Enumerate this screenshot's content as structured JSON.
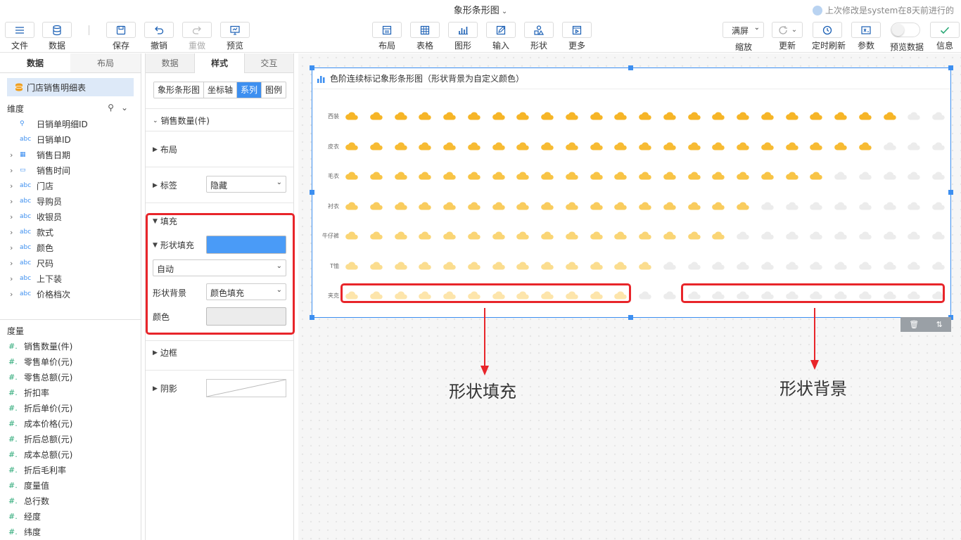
{
  "header": {
    "title": "象形条形图",
    "last_modified": "上次修改是system在8天前进行的"
  },
  "toolbar_left": [
    {
      "name": "file-button",
      "icon": "menu-icon",
      "label": "文件",
      "disabled": false
    },
    {
      "name": "data-button",
      "icon": "database-icon",
      "label": "数据",
      "disabled": false
    },
    {
      "name": "save-button",
      "icon": "save-icon",
      "label": "保存",
      "disabled": false
    },
    {
      "name": "undo-button",
      "icon": "undo-icon",
      "label": "撤销",
      "disabled": false
    },
    {
      "name": "redo-button",
      "icon": "redo-icon",
      "label": "重做",
      "disabled": true
    },
    {
      "name": "preview-button",
      "icon": "monitor-icon",
      "label": "预览",
      "disabled": false
    }
  ],
  "toolbar_center": [
    {
      "name": "layout-button",
      "icon": "layout-icon",
      "label": "布局"
    },
    {
      "name": "table-button",
      "icon": "table-icon",
      "label": "表格"
    },
    {
      "name": "chart-button",
      "icon": "bar-chart-icon",
      "label": "图形"
    },
    {
      "name": "input-button",
      "icon": "edit-icon",
      "label": "输入"
    },
    {
      "name": "shape-button",
      "icon": "shapes-icon",
      "label": "形状"
    },
    {
      "name": "more-button",
      "icon": "play-box-icon",
      "label": "更多"
    }
  ],
  "toolbar_right": {
    "zoom_value": "满屏",
    "zoom_label": "缩放",
    "refresh_label": "更新",
    "timed_refresh_label": "定时刷新",
    "params_label": "参数",
    "preview_data_label": "预览数据",
    "info_label": "信息"
  },
  "left_panel": {
    "tabs": [
      "数据",
      "布局"
    ],
    "dataset": "门店销售明细表",
    "dimension_title": "维度",
    "dimensions": [
      {
        "type": "key",
        "name": "日销单明细ID",
        "expandable": false
      },
      {
        "type": "abc",
        "name": "日销单ID",
        "expandable": false
      },
      {
        "type": "date",
        "name": "销售日期",
        "expandable": true
      },
      {
        "type": "time",
        "name": "销售时间",
        "expandable": true
      },
      {
        "type": "abc",
        "name": "门店",
        "expandable": true
      },
      {
        "type": "abc",
        "name": "导购员",
        "expandable": true
      },
      {
        "type": "abc",
        "name": "收银员",
        "expandable": true
      },
      {
        "type": "abc",
        "name": "款式",
        "expandable": true
      },
      {
        "type": "abc",
        "name": "颜色",
        "expandable": true
      },
      {
        "type": "abc",
        "name": "尺码",
        "expandable": true
      },
      {
        "type": "abc",
        "name": "上下装",
        "expandable": true
      },
      {
        "type": "abc",
        "name": "价格档次",
        "expandable": true
      }
    ],
    "measure_title": "度量",
    "measures": [
      "销售数量(件)",
      "零售单价(元)",
      "零售总额(元)",
      "折扣率",
      "折后单价(元)",
      "成本价格(元)",
      "折后总额(元)",
      "成本总额(元)",
      "折后毛利率",
      "度量值",
      "总行数",
      "经度",
      "纬度"
    ]
  },
  "prop_panel": {
    "tabs": [
      "数据",
      "样式",
      "交互"
    ],
    "subtabs": [
      "象形条形图",
      "坐标轴",
      "系列",
      "图例"
    ],
    "series_name": "销售数量(件)",
    "layout_label": "布局",
    "label_label": "标签",
    "label_value": "隐藏",
    "fill_label": "填充",
    "shape_fill_label": "形状填充",
    "shape_fill_color": "#4a9bf7",
    "auto_value": "自动",
    "shape_bg_label": "形状背景",
    "shape_bg_value": "颜色填充",
    "color_label": "颜色",
    "color_value": "#ececec",
    "border_label": "边框",
    "shadow_label": "阴影"
  },
  "widget": {
    "title": "色阶连续标记象形条形图（形状背景为自定义颜色）"
  },
  "chart_data": {
    "type": "bar",
    "orientation": "horizontal-pictorial",
    "symbol": "cloud-icon",
    "max_symbols": 25,
    "categories": [
      "西装",
      "皮衣",
      "毛衣",
      "衬衣",
      "牛仔裤",
      "T恤",
      "夹克"
    ],
    "values": [
      23,
      22,
      20,
      17,
      16,
      13,
      12
    ],
    "fill_colors": [
      "#f6b527",
      "#f7bb33",
      "#f8c446",
      "#f9cc5e",
      "#fad575",
      "#fbdd8f",
      "#fde5ab"
    ],
    "background_color": "#ececec"
  },
  "annotations": {
    "fill": "形状填充",
    "background": "形状背景"
  }
}
